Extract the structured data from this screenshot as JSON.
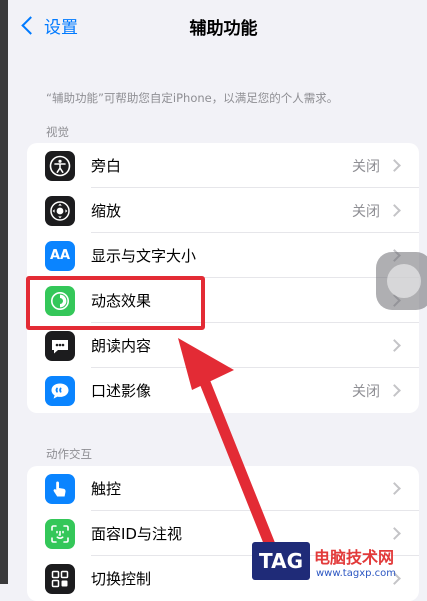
{
  "nav": {
    "back_label": "设置",
    "title": "辅助功能"
  },
  "description": "“辅助功能”可帮助您自定iPhone，以满足您的个人需求。",
  "sections": {
    "vision": {
      "header": "视觉"
    },
    "interaction": {
      "header": "动作交互"
    }
  },
  "vision_items": [
    {
      "label": "旁白",
      "value": "关闭",
      "icon": "voiceover-icon",
      "color": "#1c1c1e"
    },
    {
      "label": "缩放",
      "value": "关闭",
      "icon": "zoom-icon",
      "color": "#1c1c1e"
    },
    {
      "label": "显示与文字大小",
      "value": "",
      "icon": "display-text-size-icon",
      "color": "#0a84ff",
      "icon_text": "AA"
    },
    {
      "label": "动态效果",
      "value": "",
      "icon": "motion-icon",
      "color": "#34c759"
    },
    {
      "label": "朗读内容",
      "value": "",
      "icon": "spoken-content-icon",
      "color": "#1c1c1e"
    },
    {
      "label": "口述影像",
      "value": "关闭",
      "icon": "audio-description-icon",
      "color": "#0a84ff"
    }
  ],
  "interaction_items": [
    {
      "label": "触控",
      "value": "",
      "icon": "touch-icon",
      "color": "#0a84ff"
    },
    {
      "label": "面容ID与注视",
      "value": "",
      "icon": "face-id-icon",
      "color": "#34c759"
    },
    {
      "label": "切换控制",
      "value": "",
      "icon": "switch-control-icon",
      "color": "#1c1c1e"
    }
  ],
  "annotation": {
    "highlight_color": "#e32b35"
  },
  "watermark": {
    "tag": "TAG",
    "title": "电脑技术网",
    "url": "www.tagxp.com"
  }
}
